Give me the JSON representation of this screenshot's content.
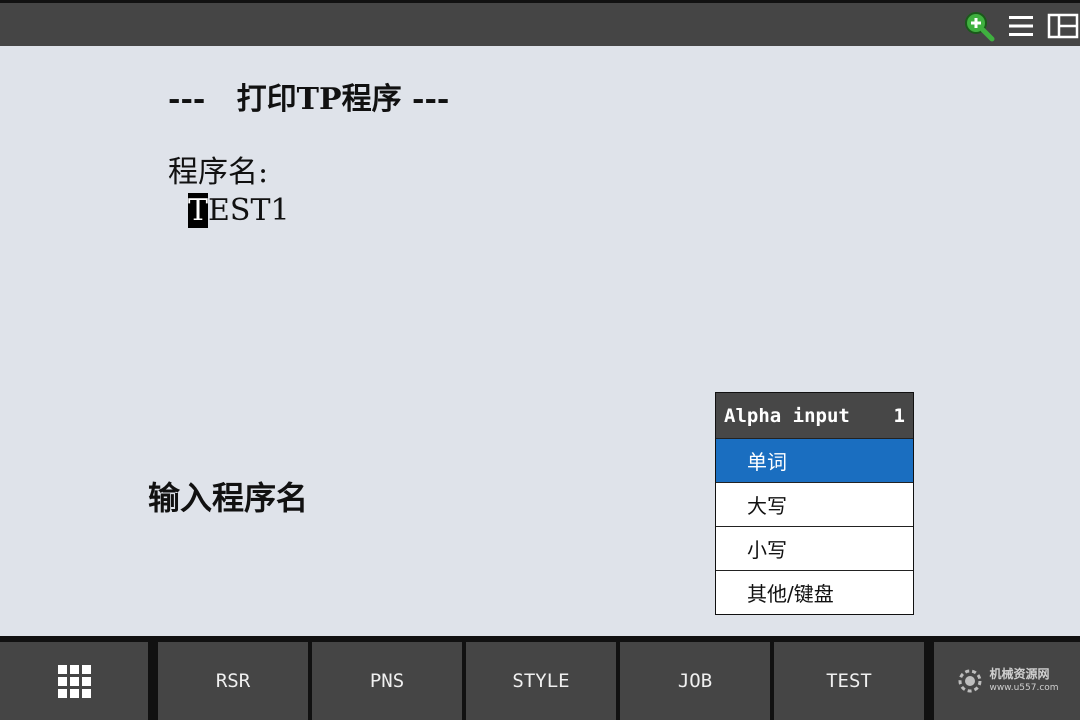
{
  "top_bar": {
    "icons": [
      "zoom-in-icon",
      "menu-icon",
      "layout-icon"
    ]
  },
  "screen": {
    "title": "---   打印TP程序 ---",
    "program_name_label": "程序名:",
    "program_value_cursor_char": "T",
    "program_value_rest": "EST1",
    "prompt": "输入程序名"
  },
  "alpha_popup": {
    "title": "Alpha input",
    "number": "1",
    "items": [
      {
        "label": "单词",
        "selected": true
      },
      {
        "label": "大写",
        "selected": false
      },
      {
        "label": "小写",
        "selected": false
      },
      {
        "label": "其他/键盘",
        "selected": false
      }
    ]
  },
  "function_keys": {
    "menu_icon": "grid-menu-icon",
    "f1": "RSR",
    "f2": "PNS",
    "f3": "STYLE",
    "f4": "JOB",
    "f5": "TEST"
  },
  "watermark": {
    "line1": "机械资源网",
    "line2": "www.u557.com"
  },
  "colors": {
    "background": "#dfe3ea",
    "bar": "#454545",
    "selected": "#1a6ec0",
    "zoom_icon": "#3fb03f"
  }
}
